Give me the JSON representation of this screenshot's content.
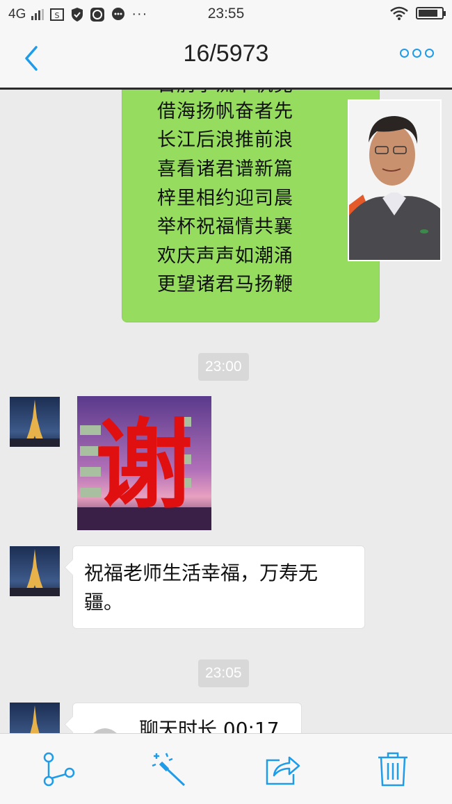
{
  "status_bar": {
    "network": "4G",
    "time": "23:55",
    "battery_level": 0.85
  },
  "header": {
    "title": "16/5973"
  },
  "poem": {
    "lines": [
      "百舸争流千帆竞",
      "借海扬帆奋者先",
      "长江后浪推前浪",
      "喜看诸君谱新篇",
      "梓里相约迎司晨",
      "举杯祝福情共襄",
      "欢庆声声如潮涌",
      "更望诸君马扬鞭"
    ]
  },
  "messages": {
    "ts1": "23:00",
    "sticker_char": "谢",
    "blessing": "祝福老师生活幸福，万寿无疆。",
    "ts2": "23:05",
    "call": "聊天时长 00:17"
  },
  "toolbar": {
    "items": [
      "share-branch-icon",
      "magic-wand-icon",
      "forward-icon",
      "trash-icon"
    ]
  },
  "colors": {
    "accent": "#1e9be9",
    "sent_bubble": "#95dc5f"
  }
}
